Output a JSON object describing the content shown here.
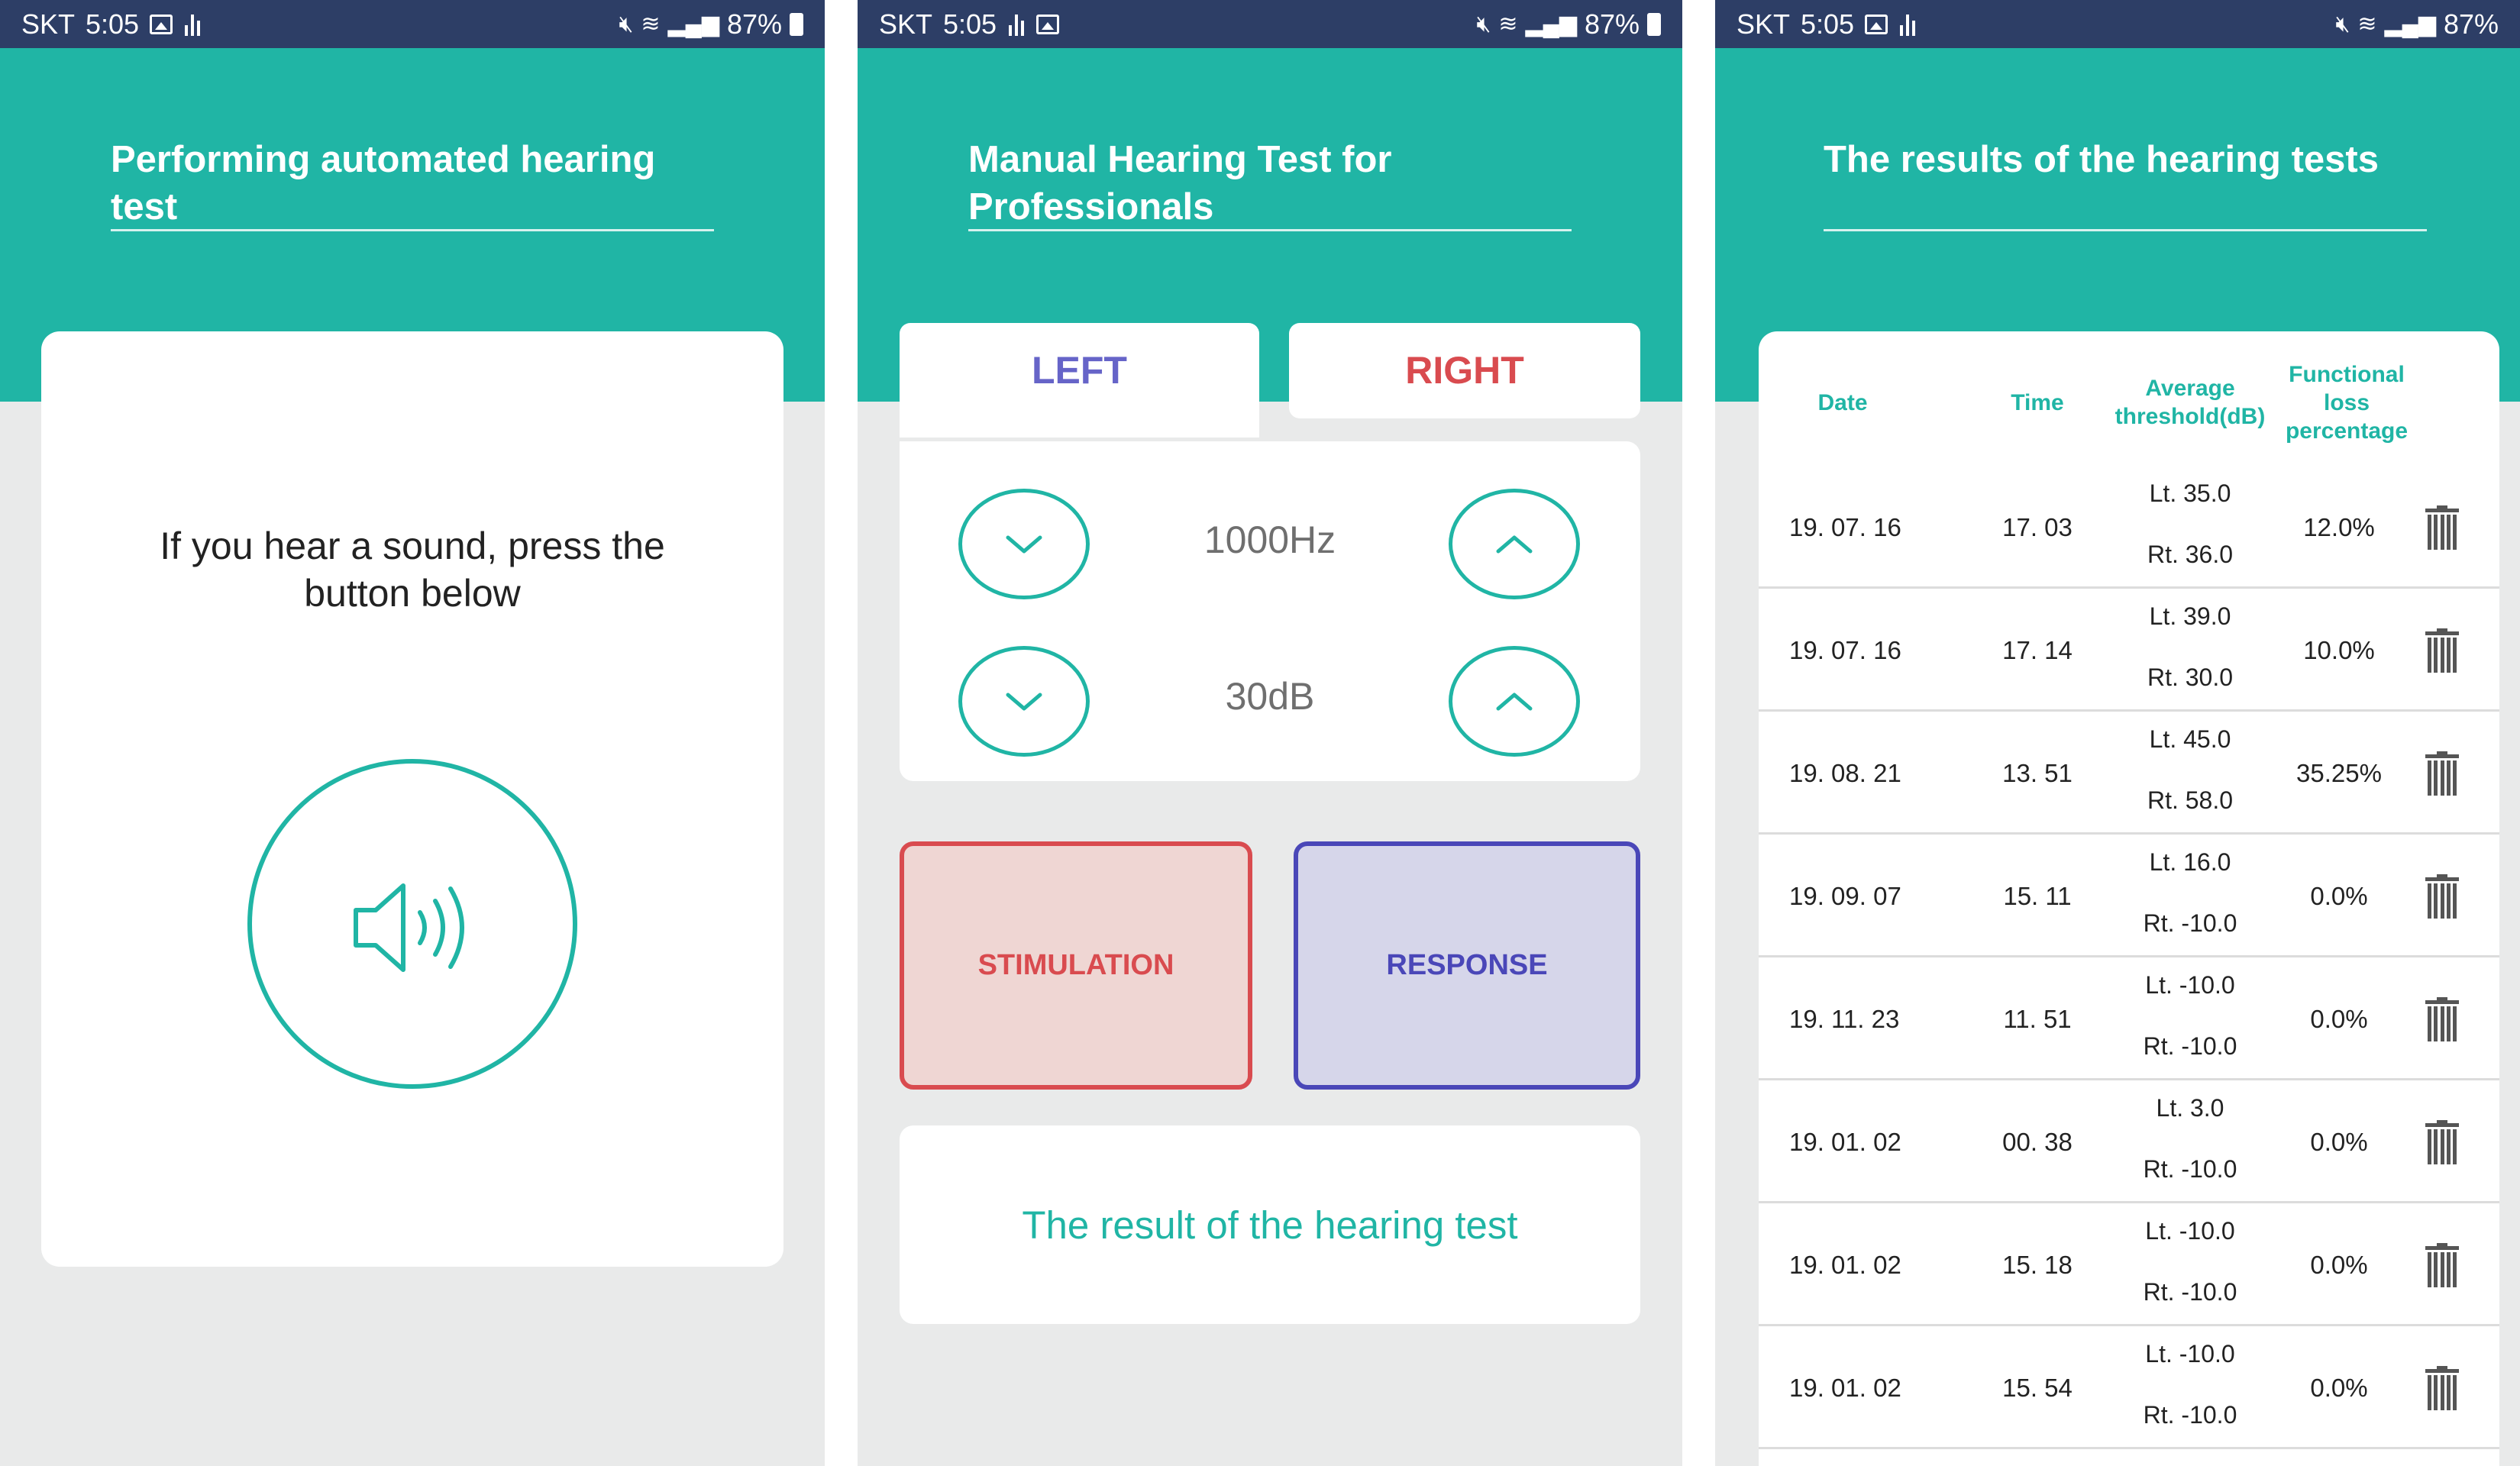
{
  "status_bar": {
    "carrier": "SKT",
    "time": "5:05",
    "battery": "87%"
  },
  "screen1": {
    "title": "Performing automated hearing test",
    "prompt_line1": "If you hear a sound, press the",
    "prompt_line2": "button below",
    "sound_button_icon": "speaker-sound-icon"
  },
  "screen2": {
    "title_line1": "Manual Hearing Test for",
    "title_line2": "Professionals",
    "tab_left": "LEFT",
    "tab_right": "RIGHT",
    "frequency": "1000Hz",
    "level": "30dB",
    "stimulation_label": "STIMULATION",
    "response_label": "RESPONSE",
    "result_label": "The result of the hearing test"
  },
  "screen3": {
    "title": "The results of the hearing tests",
    "columns": {
      "date": "Date",
      "time": "Time",
      "avg_line1": "Average",
      "avg_line2": "threshold(dB)",
      "loss_line1": "Functional",
      "loss_line2": "loss",
      "loss_line3": "percentage"
    },
    "rows": [
      {
        "date": "19. 07. 16",
        "time": "17. 03",
        "left": "Lt. 35.0",
        "right": "Rt. 36.0",
        "loss": "12.0%"
      },
      {
        "date": "19. 07. 16",
        "time": "17. 14",
        "left": "Lt. 39.0",
        "right": "Rt. 30.0",
        "loss": "10.0%"
      },
      {
        "date": "19. 08. 21",
        "time": "13. 51",
        "left": "Lt. 45.0",
        "right": "Rt. 58.0",
        "loss": "35.25%"
      },
      {
        "date": "19. 09. 07",
        "time": "15. 11",
        "left": "Lt. 16.0",
        "right": "Rt. -10.0",
        "loss": "0.0%"
      },
      {
        "date": "19. 11. 23",
        "time": "11. 51",
        "left": "Lt. -10.0",
        "right": "Rt. -10.0",
        "loss": "0.0%"
      },
      {
        "date": "19. 01. 02",
        "time": "00. 38",
        "left": "Lt. 3.0",
        "right": "Rt. -10.0",
        "loss": "0.0%"
      },
      {
        "date": "19. 01. 02",
        "time": "15. 18",
        "left": "Lt. -10.0",
        "right": "Rt. -10.0",
        "loss": "0.0%"
      },
      {
        "date": "19. 01. 02",
        "time": "15. 54",
        "left": "Lt. -10.0",
        "right": "Rt. -10.0",
        "loss": "0.0%"
      }
    ]
  },
  "colors": {
    "teal": "#20b5a5",
    "status_bar": "#2d3e66",
    "left_accent": "#6664c8",
    "right_accent": "#d94b4f",
    "response_accent": "#4a47b8"
  }
}
